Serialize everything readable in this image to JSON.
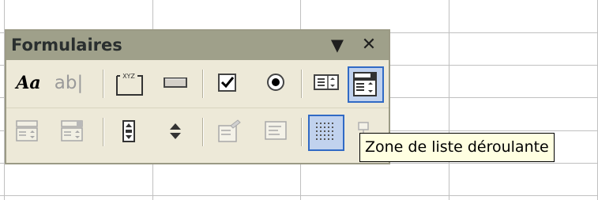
{
  "toolbar": {
    "title": "Formulaires",
    "dropdown_icon": "triangle-down-icon",
    "close_icon": "close-x-icon",
    "close_glyph": "✕",
    "dropdown_glyph": "▼",
    "row1": [
      {
        "name": "label-tool-button",
        "icon": "label-aa-icon",
        "text": "Aa"
      },
      {
        "name": "edit-box-tool-button",
        "icon": "edit-box-ab-icon",
        "text": "ab|"
      },
      {
        "name": "group-box-tool-button",
        "icon": "group-box-xyz-icon",
        "text": "XYZ"
      },
      {
        "name": "push-button-tool-button",
        "icon": "button-icon"
      },
      {
        "name": "checkbox-tool-button",
        "icon": "checkbox-checked-icon"
      },
      {
        "name": "option-button-tool-button",
        "icon": "radio-selected-icon"
      },
      {
        "name": "list-box-tool-button",
        "icon": "list-box-icon"
      },
      {
        "name": "combo-box-tool-button",
        "icon": "combo-box-icon",
        "highlighted": true
      }
    ],
    "row2": [
      {
        "name": "combo-list-edit-tool-button",
        "icon": "combo-list-edit-icon",
        "disabled": true
      },
      {
        "name": "combo-dropdown-edit-tool-button",
        "icon": "combo-dropdown-edit-icon",
        "disabled": true
      },
      {
        "name": "scrollbar-tool-button",
        "icon": "scrollbar-icon"
      },
      {
        "name": "spinner-tool-button",
        "icon": "spinner-icon"
      },
      {
        "name": "control-properties-button",
        "icon": "control-properties-icon",
        "disabled": true
      },
      {
        "name": "edit-code-button",
        "icon": "edit-code-icon",
        "disabled": true
      },
      {
        "name": "toggle-grid-button",
        "icon": "grid-icon",
        "highlighted": true
      },
      {
        "name": "run-dialog-button",
        "icon": "run-dialog-icon",
        "disabled": true
      }
    ]
  },
  "tooltip": {
    "text": "Zone de liste déroulante"
  },
  "colors": {
    "titlebar": "#9fa08a",
    "toolbar_bg": "#ede9d8",
    "highlight_bg": "#c1d2ee",
    "highlight_border": "#316ac5",
    "tooltip_bg": "#ffffe1",
    "grid_line": "#c0c0c0"
  }
}
